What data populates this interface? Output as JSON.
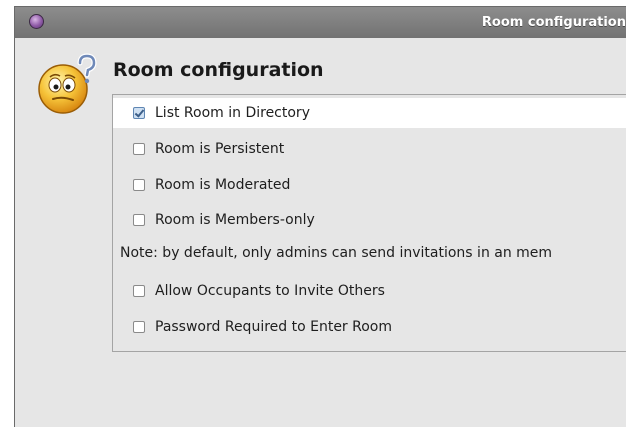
{
  "window": {
    "title": "Room configuration"
  },
  "dialog": {
    "heading": "Room configuration",
    "icon": "confused-smiley-question-icon"
  },
  "options": [
    {
      "label": "List Room in Directory",
      "checked": true
    },
    {
      "label": "Room is Persistent",
      "checked": false
    },
    {
      "label": "Room is Moderated",
      "checked": false
    },
    {
      "label": "Room is Members-only",
      "checked": false
    },
    {
      "label": "Allow Occupants to Invite Others",
      "checked": false
    },
    {
      "label": "Password Required to Enter Room",
      "checked": false
    }
  ],
  "note": "Note: by default, only admins can send invitations in an mem"
}
